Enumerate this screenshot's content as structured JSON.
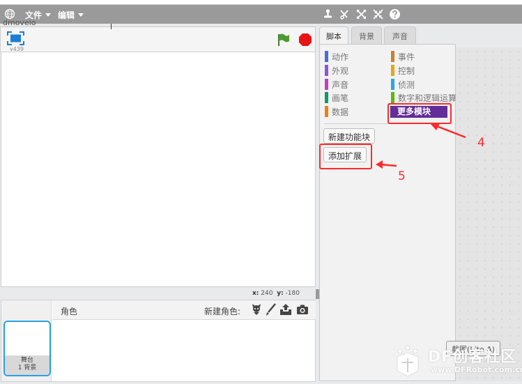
{
  "menubar": {
    "globe_icon": "globe-icon",
    "file_label": "文件",
    "edit_label": "编辑",
    "tools": [
      "stamp-icon",
      "cut-icon",
      "grow-icon",
      "shrink-icon",
      "help-icon"
    ]
  },
  "overlay": {
    "text": "dmoveio"
  },
  "stage": {
    "version": "v439",
    "fullscreen_icon": "fullscreen-icon",
    "flag_icon": "green-flag-icon",
    "stop_icon": "stop-sign-icon",
    "x_label": "x:",
    "x_value": "240",
    "y_label": "y:",
    "y_value": "-180"
  },
  "sprites": {
    "title": "角色",
    "new_sprite_label": "新建角色:",
    "new_sprite_icons": [
      "sprite-library-icon",
      "paint-brush-icon",
      "upload-icon",
      "camera-icon"
    ],
    "stage_label": "舞台",
    "backdrop_count": "1 背景"
  },
  "tabs": [
    {
      "label": "脚本",
      "active": true
    },
    {
      "label": "背景",
      "active": false
    },
    {
      "label": "声音",
      "active": false
    }
  ],
  "categories_left": [
    {
      "label": "动作",
      "color": "#4a6cd4"
    },
    {
      "label": "外观",
      "color": "#8a55d7"
    },
    {
      "label": "声音",
      "color": "#bb42c3"
    },
    {
      "label": "画笔",
      "color": "#0e9a6c"
    },
    {
      "label": "数据",
      "color": "#ee7d16"
    }
  ],
  "categories_right": [
    {
      "label": "事件",
      "color": "#c88330"
    },
    {
      "label": "控制",
      "color": "#e1a91a"
    },
    {
      "label": "侦测",
      "color": "#2ca5e2"
    },
    {
      "label": "数字和逻辑运算",
      "color": "#5cb712"
    }
  ],
  "more_blocks": {
    "label": "更多模块",
    "color": "#632d99"
  },
  "buttons": {
    "new_block": "新建功能块",
    "add_extension": "添加扩展"
  },
  "script_area": {
    "button_label": "截图(Lite A)"
  },
  "annotations": {
    "step4": "4",
    "step5": "5",
    "color": "#ff2a2a"
  },
  "watermark": {
    "text": "DF创客社区",
    "url": "www.DFRobot.com.cn"
  }
}
